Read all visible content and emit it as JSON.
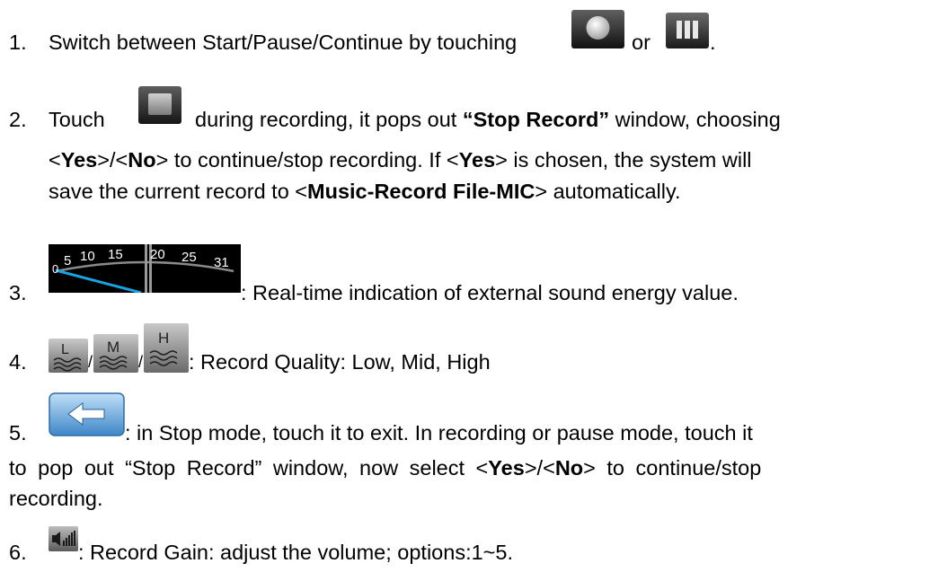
{
  "items": [
    {
      "number": "1.",
      "text_a": "Switch between Start/Pause/Continue by touching",
      "text_or": "or",
      "text_end": ".",
      "icons": [
        "record-circle-icon",
        "pause-icon"
      ]
    },
    {
      "number": "2.",
      "line1_a": "Touch",
      "line1_b": "during recording, it pops out",
      "line1_bold": "“Stop Record”",
      "line1_c": "window, choosing",
      "line2_lt1": "<",
      "line2_yes": "Yes",
      "line2_mid": ">/<",
      "line2_no": "No",
      "line2_b": "> to continue/stop recording. If <",
      "line2_yes2": "Yes",
      "line2_c": "> is chosen, the system will",
      "line3_a": "save the current record to <",
      "line3_bold": "Music-Record File-MIC",
      "line3_b": "> automatically.",
      "icons": [
        "stop-square-icon"
      ]
    },
    {
      "number": "3.",
      "text": ": Real-time indication of external sound energy value.",
      "meter_ticks": [
        "0",
        "5",
        "10",
        "15",
        "20",
        "25",
        "31"
      ],
      "icons": [
        "sound-meter-icon"
      ]
    },
    {
      "number": "4.",
      "sep": "/",
      "text": ": Record Quality: Low, Mid, High",
      "quality_letters": [
        "L",
        "M",
        "H"
      ],
      "icons": [
        "quality-low-icon",
        "quality-mid-icon",
        "quality-high-icon"
      ]
    },
    {
      "number": "5.",
      "line1": ": in Stop mode, touch it to exit. In recording or pause mode, touch it",
      "line2_a": "to pop out “Stop Record” window, now select <",
      "line2_yes": "Yes",
      "line2_mid": ">/<",
      "line2_no": "No",
      "line2_b": "> to continue/stop",
      "line3": "recording.",
      "icons": [
        "back-arrow-icon"
      ]
    },
    {
      "number": "6.",
      "text": ": Record Gain: adjust the volume; options:1~5.",
      "icons": [
        "speaker-gain-icon"
      ]
    }
  ],
  "colors": {
    "meter_needle": "#1aa3e0",
    "back_button": "#4a8fd0"
  }
}
